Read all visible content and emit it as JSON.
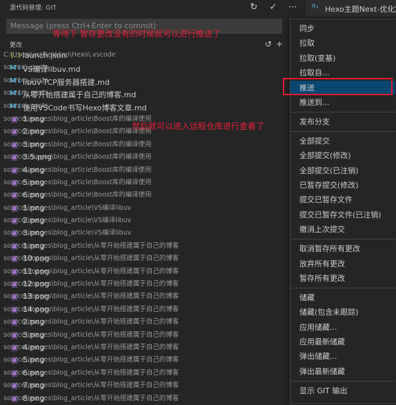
{
  "header": {
    "title": "源代码管理: GIT",
    "icons": [
      "refresh-icon",
      "check-icon",
      "ellipsis-icon"
    ]
  },
  "tab": {
    "icon": "M↓",
    "label": "Hexo主题Next-优化篇"
  },
  "commit_input": {
    "placeholder": "Message (press Ctrl+Enter to commit)"
  },
  "annotations": {
    "top": "等待下 暂存更改没有的时候就可以进行推送了",
    "middle": "然后就可以进入远程仓库进行查看了"
  },
  "section": {
    "title": "更改",
    "icons": [
      "undo-icon",
      "plus-icon"
    ]
  },
  "files": [
    {
      "type": "json",
      "name": "launch.json",
      "path": "C:\\Users\\cc\\Desktop\\Hexo\\.vscode"
    },
    {
      "type": "md",
      "name": "VS编译libuv.md",
      "path": "source\\_posts"
    },
    {
      "type": "md",
      "name": "libuv-TCP服务器搭建.md",
      "path": "source\\_posts"
    },
    {
      "type": "md",
      "name": "从零开始搭建属于自己的博客.md",
      "path": "source\\_posts"
    },
    {
      "type": "md",
      "name": "使用VSCode书写Hexo博客文章.md",
      "path": "source\\_posts"
    },
    {
      "type": "img",
      "name": "1.png",
      "path": "source\\images\\blog_article\\Boost库的编译使用"
    },
    {
      "type": "img",
      "name": "2.png",
      "path": "source\\images\\blog_article\\Boost库的编译使用"
    },
    {
      "type": "img",
      "name": "3.png",
      "path": "source\\images\\blog_article\\Boost库的编译使用"
    },
    {
      "type": "img",
      "name": "3.5.png",
      "path": "source\\images\\blog_article\\Boost库的编译使用"
    },
    {
      "type": "img",
      "name": "4.png",
      "path": "source\\images\\blog_article\\Boost库的编译使用"
    },
    {
      "type": "img",
      "name": "5.png",
      "path": "source\\images\\blog_article\\Boost库的编译使用"
    },
    {
      "type": "img",
      "name": "6.png",
      "path": "source\\images\\blog_article\\Boost库的编译使用"
    },
    {
      "type": "img",
      "name": "1.png",
      "path": "source\\images\\blog_article\\VS编译libuv"
    },
    {
      "type": "img",
      "name": "2.png",
      "path": "source\\images\\blog_article\\VS编译libuv"
    },
    {
      "type": "img",
      "name": "3.png",
      "path": "source\\images\\blog_article\\VS编译libuv"
    },
    {
      "type": "img",
      "name": "1.png",
      "path": "source\\images\\blog_article\\从零开始搭建属于自己的博客"
    },
    {
      "type": "img",
      "name": "10.png",
      "path": "source\\images\\blog_article\\从零开始搭建属于自己的博客"
    },
    {
      "type": "img",
      "name": "11.png",
      "path": "source\\images\\blog_article\\从零开始搭建属于自己的博客"
    },
    {
      "type": "img",
      "name": "12.png",
      "path": "source\\images\\blog_article\\从零开始搭建属于自己的博客"
    },
    {
      "type": "img",
      "name": "13.png",
      "path": "source\\images\\blog_article\\从零开始搭建属于自己的博客"
    },
    {
      "type": "img",
      "name": "14.png",
      "path": "source\\images\\blog_article\\从零开始搭建属于自己的博客"
    },
    {
      "type": "img",
      "name": "2.png",
      "path": "source\\images\\blog_article\\从零开始搭建属于自己的博客"
    },
    {
      "type": "img",
      "name": "3.png",
      "path": "source\\images\\blog_article\\从零开始搭建属于自己的博客"
    },
    {
      "type": "img",
      "name": "4.png",
      "path": "source\\images\\blog_article\\从零开始搭建属于自己的博客"
    },
    {
      "type": "img",
      "name": "5.png",
      "path": "source\\images\\blog_article\\从零开始搭建属于自己的博客"
    },
    {
      "type": "img",
      "name": "6.png",
      "path": "source\\images\\blog_article\\从零开始搭建属于自己的博客"
    },
    {
      "type": "img",
      "name": "7.png",
      "path": "source\\images\\blog_article\\从零开始搭建属于自己的博客"
    },
    {
      "type": "img",
      "name": "8.png",
      "path": "source\\images\\blog_article\\从零开始搭建属于自己的博客"
    }
  ],
  "menu": {
    "selected": "推送",
    "groups": [
      [
        "同步",
        "拉取",
        "拉取(变基)",
        "拉取自...",
        "推送",
        "推送到..."
      ],
      [
        "发布分支"
      ],
      [
        "全部提交",
        "全部提交(修改)",
        "全部提交(已注销)",
        "已暂存提交(修改)",
        "提交已暂存文件",
        "提交已暂存文件(已注销)",
        "撤消上次提交"
      ],
      [
        "取消暂存所有更改",
        "放弃所有更改",
        "暂存所有更改"
      ],
      [
        "储藏",
        "储藏(包含未跟踪)",
        "应用储藏...",
        "应用最新储藏",
        "弹出储藏...",
        "弹出最新储藏"
      ],
      [
        "显示 GIT 输出"
      ]
    ]
  },
  "colors": {
    "background": "#252526",
    "menu_selected": "#094771",
    "annotation": "#e6203a",
    "highlight_box": "#e21a2f"
  }
}
